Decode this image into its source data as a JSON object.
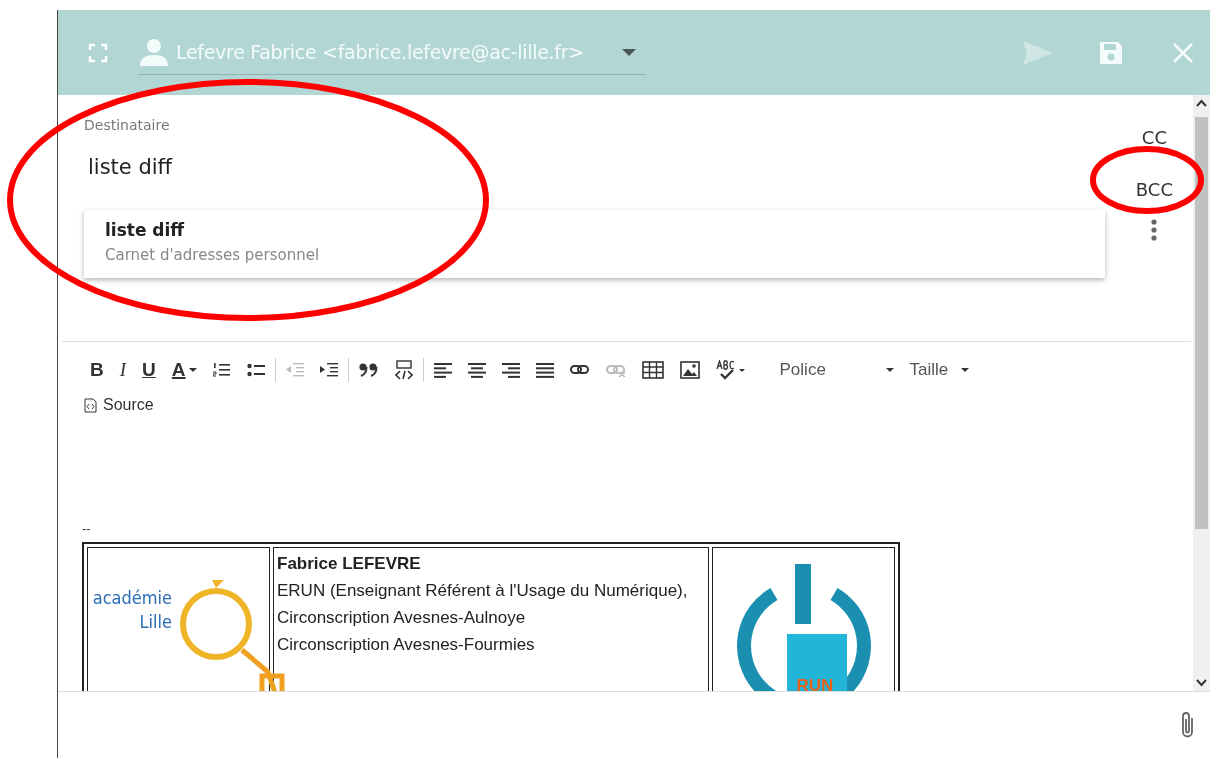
{
  "header": {
    "sender": "Lefevre Fabrice <fabrice.lefevre@ac-lille.fr>",
    "send_disabled": true
  },
  "recipients": {
    "label": "Destinataire",
    "value": "liste diff",
    "suggestion": {
      "name": "liste diff",
      "source": "Carnet d'adresses personnel"
    },
    "cc": "CC",
    "bcc": "BCC"
  },
  "toolbar": [
    {
      "kind": "bold",
      "label": "B",
      "disabled": false
    },
    {
      "kind": "italic",
      "label": "I",
      "disabled": false
    },
    {
      "kind": "underline",
      "label": "U",
      "disabled": false
    },
    {
      "kind": "textcolor",
      "label": "A",
      "disabled": false
    },
    {
      "kind": "numbered",
      "disabled": false
    },
    {
      "kind": "bulleted",
      "disabled": false
    },
    {
      "kind": "separator"
    },
    {
      "kind": "outdent",
      "disabled": true
    },
    {
      "kind": "indent",
      "disabled": false
    },
    {
      "kind": "separator"
    },
    {
      "kind": "quote",
      "disabled": false
    },
    {
      "kind": "div",
      "disabled": false
    },
    {
      "kind": "separator"
    },
    {
      "kind": "alignleft",
      "disabled": false
    },
    {
      "kind": "aligncenter",
      "disabled": false
    },
    {
      "kind": "alignright",
      "disabled": false
    },
    {
      "kind": "justify",
      "disabled": false
    },
    {
      "kind": "link",
      "disabled": false
    },
    {
      "kind": "unlink",
      "disabled": true
    },
    {
      "kind": "table",
      "disabled": false
    },
    {
      "kind": "image",
      "disabled": false
    },
    {
      "kind": "spellcheck",
      "disabled": false
    },
    {
      "kind": "fontfamily",
      "label": "Police"
    },
    {
      "kind": "fontsize",
      "label": "Taille"
    }
  ],
  "source_button": "Source",
  "body": {
    "separator": "--",
    "signature": {
      "logo_left": [
        "académie",
        "Lille"
      ],
      "name": "Fabrice LEFEVRE",
      "lines": [
        "ERUN (Enseignant Référent à l'Usage du Numérique),",
        "Circonscription Avesnes-Aulnoye",
        "Circonscription Avesnes-Fourmies"
      ],
      "logo_right": "RUN"
    }
  }
}
